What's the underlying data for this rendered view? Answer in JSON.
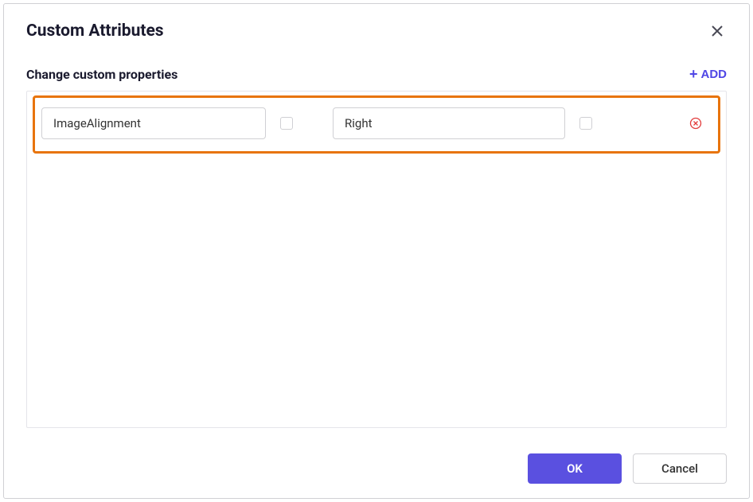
{
  "dialog": {
    "title": "Custom Attributes",
    "section_title": "Change custom properties",
    "add_button_label": "ADD"
  },
  "attribute_row": {
    "name_value": "ImageAlignment",
    "value_value": "Right"
  },
  "footer": {
    "ok_label": "OK",
    "cancel_label": "Cancel"
  }
}
